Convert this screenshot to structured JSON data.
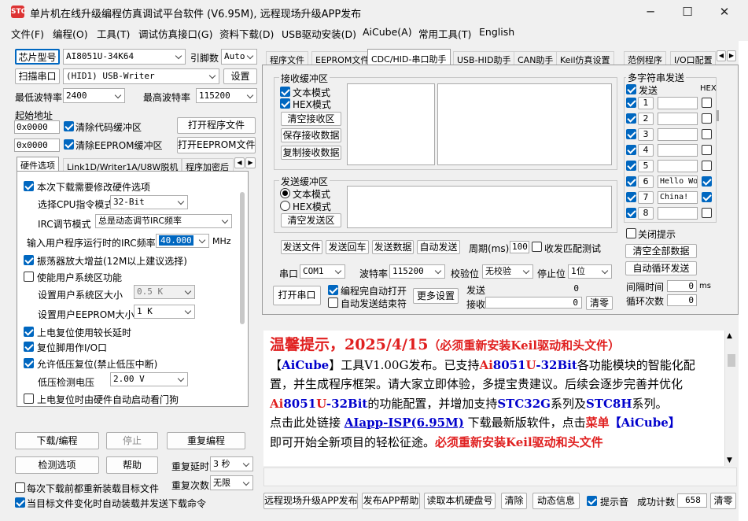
{
  "window": {
    "title": "单片机在线升级编程仿真调试平台软件 (V6.95M), 远程现场升级APP发布",
    "icon": "STC",
    "min": "─",
    "max": "☐",
    "close": "✕"
  },
  "menu": [
    "文件(F)",
    "编程(O)",
    "工具(T)",
    "调试仿真接口(G)",
    "资料下载(D)",
    "USB驱动安装(D)",
    "AiCube(A)",
    "常用工具(T)",
    "English"
  ],
  "left": {
    "chip_btn": "芯片型号",
    "chip_value": "AI8051U-34K64",
    "pin_label": "引脚数",
    "pin_value": "Auto",
    "scan_btn": "扫描串口",
    "port_value": "(HID1) USB-Writer",
    "settings_btn": "设置",
    "min_baud_label": "最低波特率",
    "min_baud": "2400",
    "max_baud_label": "最高波特率",
    "max_baud": "115200",
    "start_addr_label": "起始地址",
    "addr1": "0x0000",
    "clear_code": "清除代码缓冲区",
    "open_prog": "打开程序文件",
    "addr2": "0x0000",
    "clear_eeprom": "清除EEPROM缓冲区",
    "open_eeprom": "打开EEPROM文件",
    "tabs": [
      "硬件选项",
      "Link1D/Writer1A/U8W脱机",
      "程序加密后"
    ],
    "hw": {
      "opt_modify": "本次下载需要修改硬件选项",
      "cpu_label": "选择CPU指令模式",
      "cpu_value": "32-Bit",
      "irc_mode_label": "IRC调节模式",
      "irc_mode_value": "总是动态调节IRC频率",
      "freq_label": "输入用户程序运行时的IRC频率",
      "freq_value": "40.000",
      "freq_unit": "MHz",
      "osc_gain": "振荡器放大增益(12M以上建议选择)",
      "user_sys": "使能用户系统区功能",
      "sys_size_label": "设置用户系统区大小",
      "sys_size": "0.5 K",
      "eeprom_size_label": "设置用户EEPROM大小",
      "eeprom_size": "1   K",
      "reset_delay": "上电复位使用较长延时",
      "reset_io": "复位脚用作I/O口",
      "lvr": "允许低压复位(禁止低压中断)",
      "lvd_label": "低压检测电压",
      "lvd_value": "2.00 V",
      "wdt": "上电复位时由硬件自动启动看门狗"
    },
    "download_btn": "下载/编程",
    "stop_btn": "停止",
    "redownload_btn": "重复编程",
    "check_btn": "检测选项",
    "help_btn": "帮助",
    "repeat_delay_label": "重复延时",
    "repeat_delay": "3 秒",
    "repeat_count_label": "重复次数",
    "repeat_count": "无限",
    "reload_each": "每次下载前都重新装载目标文件",
    "auto_reload": "当目标文件变化时自动装载并发送下载命令"
  },
  "right": {
    "tabs": [
      "程序文件",
      "EEPROM文件",
      "CDC/HID-串口助手",
      "USB-HID助手",
      "CAN助手",
      "Keil仿真设置",
      "范例程序",
      "I/O口配置"
    ],
    "rx": {
      "title": "接收缓冲区",
      "text_mode": "文本模式",
      "hex_mode": "HEX模式",
      "clear": "清空接收区",
      "save": "保存接收数据",
      "copy": "复制接收数据"
    },
    "tx": {
      "title": "发送缓冲区",
      "text_mode": "文本模式",
      "hex_mode": "HEX模式",
      "clear": "清空发送区"
    },
    "send_row": {
      "send_file": "发送文件",
      "send_back": "发送回车",
      "send_data": "发送数据",
      "auto_send": "自动发送",
      "period_label": "周期(ms)",
      "period": "100",
      "match_test": "收发匹配测试"
    },
    "port_row": {
      "port_label": "串口",
      "port": "COM1",
      "baud_label": "波特率",
      "baud": "115200",
      "parity_label": "校验位",
      "parity": "无校验",
      "stop_label": "停止位",
      "stop": "1位"
    },
    "open_btn": "打开串口",
    "auto_open": "编程完自动打开",
    "auto_end": "自动发送结束符",
    "more": "更多设置",
    "sent_label": "发送",
    "sent": "0",
    "recv_label": "接收",
    "recv": "0",
    "clear_btn": "清零",
    "multi": {
      "title": "多字符串发送",
      "send_hdr": "发送",
      "hex_hdr": "HEX",
      "rows": [
        {
          "n": "1",
          "v": ""
        },
        {
          "n": "2",
          "v": ""
        },
        {
          "n": "3",
          "v": ""
        },
        {
          "n": "4",
          "v": ""
        },
        {
          "n": "5",
          "v": ""
        },
        {
          "n": "6",
          "v": "Hello Wo:"
        },
        {
          "n": "7",
          "v": "China!"
        },
        {
          "n": "8",
          "v": ""
        }
      ],
      "close_tip": "关闭提示",
      "clear_all": "清空全部数据",
      "auto_loop": "自动循环发送",
      "interval_label": "间隔时间",
      "interval": "0",
      "interval_unit": "ms",
      "loop_label": "循环次数",
      "loop": "0"
    }
  },
  "notice": {
    "title": "温馨提示，2025/4/15",
    "title_note": "（必须重新安装Keil驱动和头文件）",
    "p1a": "【",
    "p1b": "AiCube",
    "p1c": "】工具V1.00G发布。已支持",
    "p1d": "Ai",
    "p1e": "8051",
    "p1f": "U",
    "p1g": "-32Bit",
    "p1h": "各功能模块的智能化配置，并生成程序框架。请大家立即体验，多提宝贵建议。后续会逐步完善并优化",
    "p1i": "Ai",
    "p1j": "8051",
    "p1k": "U",
    "p1l": "-32Bit",
    "p1m": "的功能配置，并增加支持",
    "p1n": "STC32G",
    "p1o": "系列及",
    "p1p": "STC8H",
    "p1q": "系列。",
    "p2a": "点击此处链接 ",
    "p2b": "AIapp-ISP(6.95M)",
    "p2c": " 下载最新版软件，点击",
    "p2d": "菜单",
    "p2e": "【AiCube】",
    "p2f": "即可开始全新项目的轻松征途。",
    "p2g": "必须重新安装Keil驱动和头文件"
  },
  "bottom": {
    "remote": "远程现场升级APP发布",
    "publish_help": "发布APP帮助",
    "read_disk": "读取本机硬盘号",
    "clear": "清除",
    "anim": "动态信息",
    "beep": "提示音",
    "success_label": "成功计数",
    "success": "658",
    "reset": "清零"
  },
  "colors": {
    "accent": "#0067c0",
    "notice_red": "#e02020",
    "notice_blue": "#0000cc"
  }
}
